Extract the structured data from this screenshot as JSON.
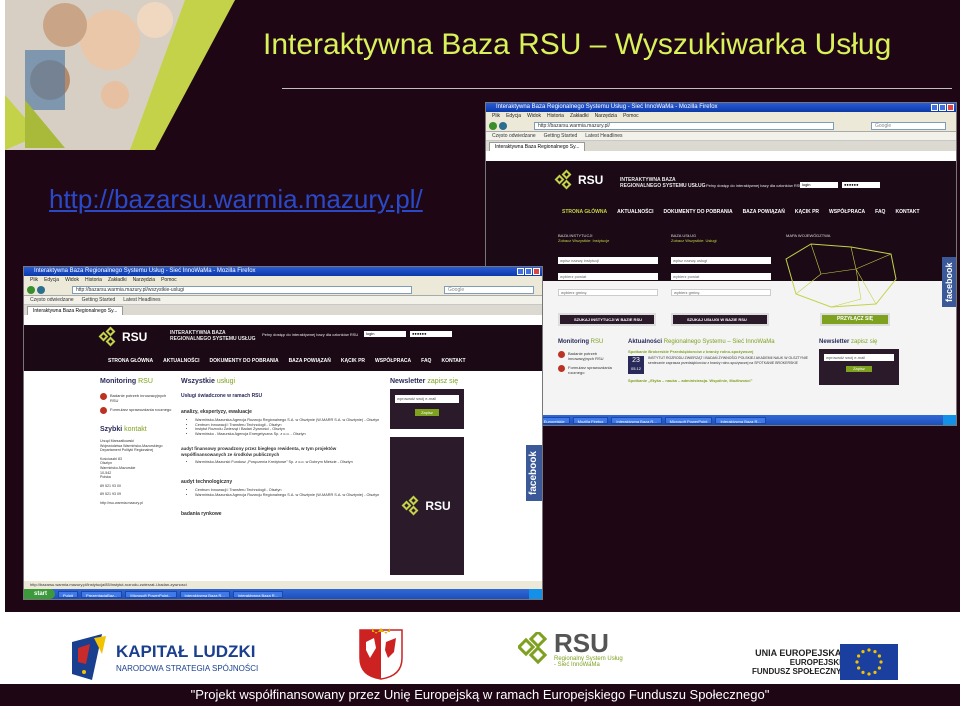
{
  "slide": {
    "title": "Interaktywna Baza RSU – Wyszukiwarka Usług",
    "url": "http://bazarsu.warmia.mazury.pl/"
  },
  "shot_back": {
    "window_title": "Interaktywna Baza Regionalnego Systemu Usług - Sieć InnoWaMa - Mozilla Firefox",
    "menu": [
      "Plik",
      "Edycja",
      "Widok",
      "Historia",
      "Zakładki",
      "Narzędzia",
      "Pomoc"
    ],
    "address": "http://bazarsu.warmia.mazury.pl/",
    "search_placeholder": "Google",
    "bookmarks": [
      "Często odwiedzane",
      "Getting Started",
      "Latest Headlines"
    ],
    "tab": "Interaktywna Baza Regionalnego Sy...",
    "site": {
      "logo": "RSU",
      "logo_sub": "Regionalny System Usług - Sieć InnoWaMa",
      "slogan_line1": "INTERAKTYWNA BAZA",
      "slogan_line2": "REGIONALNEGO SYSTEMU USŁUG",
      "tagline": "Pełny dostęp do interaktywnej bazy dla członków RSU",
      "login": "login",
      "password": "●●●●●●",
      "nav": [
        "STRONA GŁÓWNA",
        "AKTUALNOŚCI",
        "DOKUMENTY DO POBRANIA",
        "BAZA POWIĄZAŃ",
        "KĄCIK PR",
        "WSPÓŁPRACA",
        "FAQ",
        "KONTAKT"
      ],
      "baza_instytucji": "BAZA INSTYTUCJI",
      "baza_instytucji_sub": "Zobacz Wszystkie: Instytucje",
      "baza_uslug": "BAZA USŁUG",
      "baza_uslug_sub": "Zobacz Wszystkie: Usługi",
      "mapa": "MAPA WOJEWÓDZTWA",
      "input_instytucja": "wpisz nazwę instytucji",
      "input_usluga": "wpisz nazwę usługi",
      "select_powiat": "wybierz powiat",
      "select_gmina": "wybierz gminę",
      "btn_szukaj_instytucji": "SZUKAJ INSTYTUCJI W BAZIE RSU",
      "btn_szukaj_uslugi": "SZUKAJ USŁUGI W BAZIE RSU",
      "btn_przylacz": "PRZYŁĄCZ SIĘ",
      "monitoring": "Monitoring",
      "monitoring_b": "RSU",
      "monitoring_items": [
        "Badanie potrzeb innowacyjnych RSU",
        "Formularz sprawozdania rocznego"
      ],
      "aktualnosci": "Aktualności",
      "aktualnosci_b": "Regionalnego Systemu – Sieć InnoWaMa",
      "news_title": "Spotkanie Brokerskie Przedsiębiorców z branży rolno-spożywczej",
      "news_day": "23",
      "news_month": "05.12",
      "news_body": "INSTYTUT ROZRODU ZWIERZĄT I BADAŃ ŻYWNOŚCI POLSKIEJ AKADEMII NAUK W OLSZTYNIE serdecznie zaprasza przedsiębiorców z branży rolno-spożywczej na SPOTKANIE BROKERSKIE",
      "news2": "Spotkanie „Etyka – nauka – administracja. Wspólnie, Możliwości”",
      "newsletter": "Newsletter",
      "newsletter_b": "zapisz się",
      "newsletter_input": "wprowadź swój e-mail",
      "newsletter_btn": "Zapisz",
      "facebook": "facebook"
    },
    "taskbar": [
      "start",
      "Fundusze Europejskie",
      "Mozilla Firefox",
      "Interaktywna Baza R...",
      "Microsoft PowerPoint",
      "Interaktywna Baza R..."
    ]
  },
  "shot_front": {
    "window_title": "Interaktywna Baza Regionalnego Systemu Usług - Sieć InnoWaMa - Mozilla Firefox",
    "menu": [
      "Plik",
      "Edycja",
      "Widok",
      "Historia",
      "Zakładki",
      "Narzędzia",
      "Pomoc"
    ],
    "address": "http://bazarsu.warmia.mazury.pl/wszystkie-uslugi",
    "search_placeholder": "Google",
    "bookmarks": [
      "Często odwiedzane",
      "Getting Started",
      "Latest Headlines"
    ],
    "tab": "Interaktywna Baza Regionalnego Sy...",
    "site": {
      "logo": "RSU",
      "slogan_line1": "INTERAKTYWNA BAZA",
      "slogan_line2": "REGIONALNEGO SYSTEMU USŁUG",
      "tagline": "Pełny dostęp do interaktywnej bazy dla członków RSU",
      "login": "login",
      "password": "●●●●●●",
      "nav": [
        "STRONA GŁÓWNA",
        "AKTUALNOŚCI",
        "DOKUMENTY DO POBRANIA",
        "BAZA POWIĄZAŃ",
        "KĄCIK PR",
        "WSPÓŁPRACA",
        "FAQ",
        "KONTAKT"
      ],
      "monitoring": "Monitoring",
      "monitoring_b": "RSU",
      "monitoring_items": [
        "Badanie potrzeb innowacyjnych RSU",
        "Formularz sprawozdania rocznego"
      ],
      "szybki": "Szybki",
      "szybki_b": "kontakt",
      "contact": [
        "Urząd Marszałkowski",
        "Województwa Warmińsko-Mazurskiego",
        "Departament Polityki Regionalnej",
        "Kościuszki 83",
        "Olsztyn",
        "Warmińsko-Mazurskie",
        "10-542",
        "Polska",
        "89 521 93 00",
        "89 521 93 09",
        "http://rsu.warmia.mazury.pl"
      ],
      "wszystkie": "Wszystkie",
      "wszystkie_b": "usługi",
      "uslugi_head": "Usługi świadczone w ramach RSU",
      "cat1": "analizy, ekspertyzy, ewaluacje",
      "cat1_items": [
        "Warmińsko-Mazurska Agencja Rozwoju Regionalnego S.A. w Olsztynie (W-MARR S.A. w Olsztynie) - Olsztyn",
        "Centrum Innowacji i Transferu Technologii - Olsztyn",
        "Instytut Rozrodu Zwierząt i Badań Żywności - Olsztyn",
        "Warmińsko - Mazurska Agencja Energetyczna Sp. z o.o. - Olsztyn"
      ],
      "cat2": "audyt finansowy prowadzony przez biegłego rewidenta, w tym projektów współfinansowanych ze środków publicznych",
      "cat2_items": [
        "Warmińsko-Mazurski Fundusz „Poręczenia Kredytowe” Sp. z o.o. w Dobrym Mieście - Olsztyn"
      ],
      "cat3": "audyt technologiczny",
      "cat3_items": [
        "Centrum Innowacji i Transferu Technologii - Olsztyn",
        "Warmińsko-Mazurska Agencja Rozwoju Regionalnego S.A. w Olsztynie (W-MARR S.A. w Olsztynie) - Olsztyn"
      ],
      "cat4": "badania rynkowe",
      "newsletter": "Newsletter",
      "newsletter_b": "zapisz się",
      "newsletter_input": "wprowadź swój e-mail",
      "newsletter_btn": "Zapisz",
      "ad_logo": "RSU",
      "facebook": "facebook"
    },
    "status": "http://bazarsu.warmia.mazury.pl/instytucja/85/instytut-rozrodu-zwierzat-i-badan-zywnosci",
    "taskbar": [
      "start",
      "Pulpit",
      "PrezentacjaBaz...",
      "Microsoft PowerPoint...",
      "Interaktywna Baza R...",
      "Interaktywna Baza R..."
    ]
  },
  "footer": {
    "kl_title": "KAPITAŁ LUDZKI",
    "kl_sub": "NARODOWA STRATEGIA SPÓJNOŚCI",
    "rsu": "RSU",
    "rsu_sub1": "Regionalny System Usług",
    "rsu_sub2": "- Sieć InnoWaMa",
    "ue1": "UNIA EUROPEJSKA",
    "ue2": "EUROPEJSKI",
    "ue3": "FUNDUSZ SPOŁECZNY",
    "note": "\"Projekt współfinansowany przez Unię Europejską w ramach Europejskiego Funduszu Społecznego\""
  },
  "colors": {
    "slide_bg": "#1f0614",
    "title": "#d9f25a",
    "link": "#2a49c9",
    "brand_green": "#c4d24a",
    "facebook": "#3b5998"
  }
}
